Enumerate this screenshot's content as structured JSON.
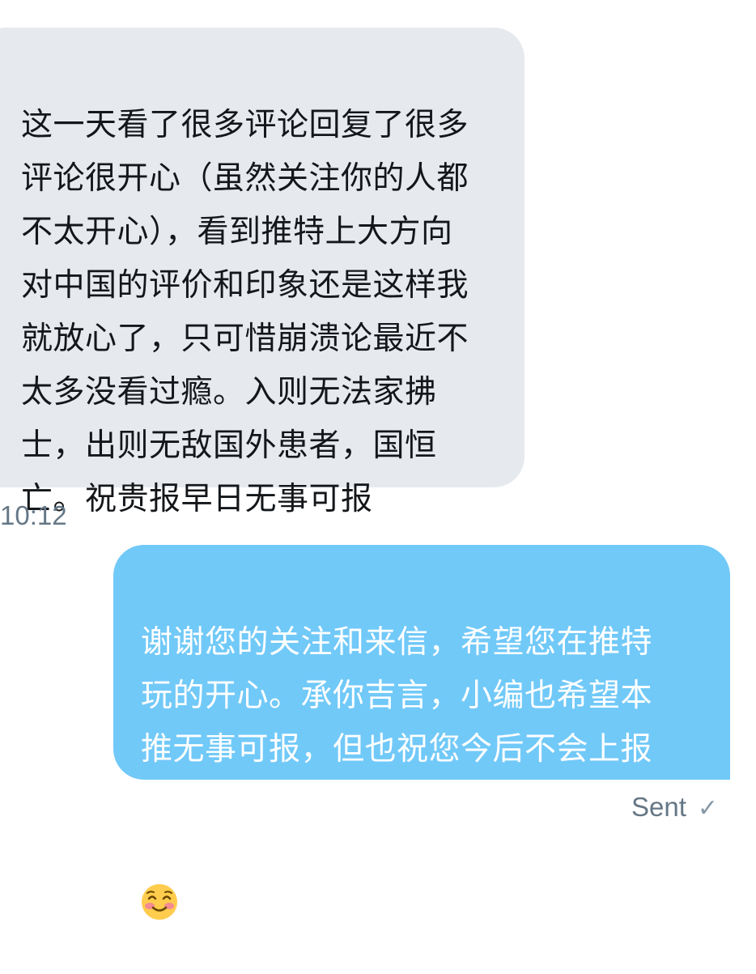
{
  "conversation": {
    "received_message": {
      "text": "这一天看了很多评论回复了很多\n评论很开心（虽然关注你的人都\n不太开心），看到推特上大方向\n对中国的评价和印象还是这样我\n就放心了，只可惜崩溃论最近不\n太多没看过瘾。入则无法家拂\n士，出则无敌国外患者，国恒\n亡。祝贵报早日无事可报",
      "timestamp": "10:12"
    },
    "sent_message": {
      "text": "谢谢您的关注和来信，希望您在推特\n玩的开心。承你吉言，小编也希望本\n推无事可报，但也祝您今后不会上报\n",
      "emoji_icon": "smiling-face-with-smiling-eyes-emoji",
      "status": "Sent"
    }
  },
  "colors": {
    "received_bubble": "#e6e9ed",
    "sent_bubble": "#71c9f8",
    "text_dark": "#14171a",
    "meta_gray": "#657786"
  }
}
